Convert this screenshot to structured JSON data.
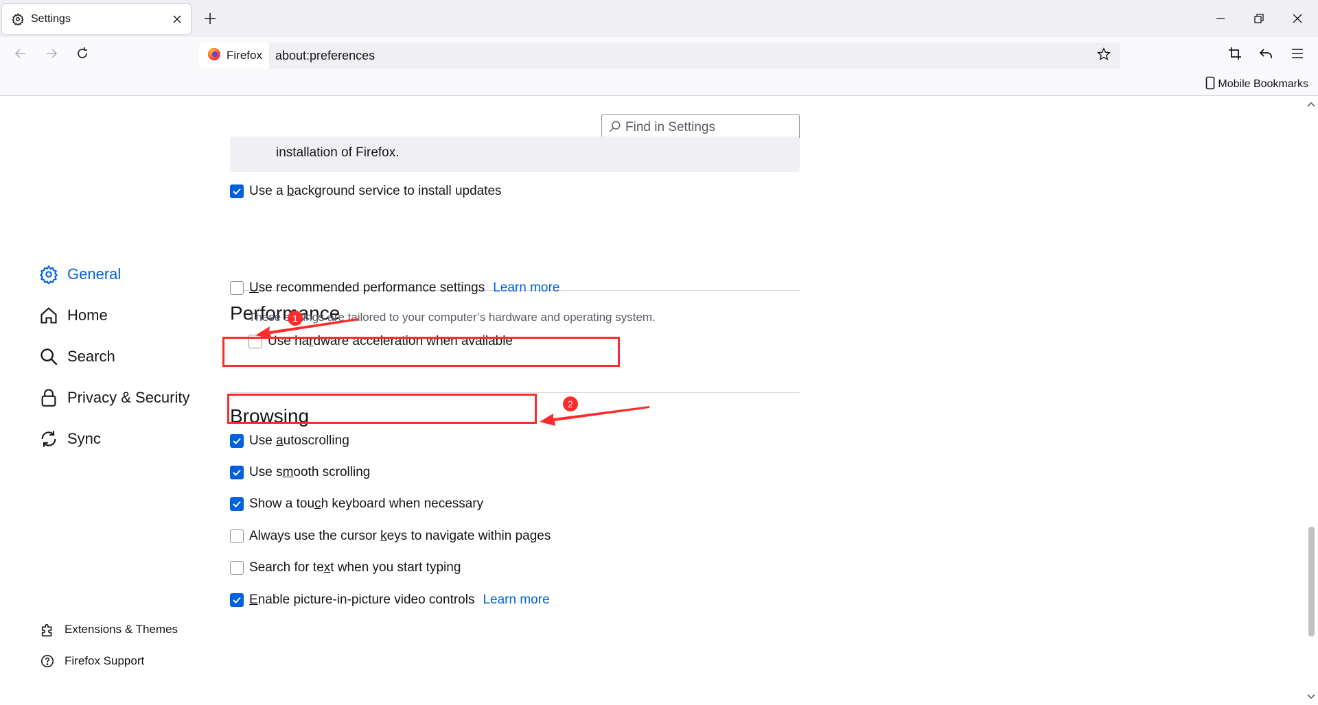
{
  "tab": {
    "title": "Settings",
    "icon": "gear-icon"
  },
  "nav": {
    "identity_label": "Firefox",
    "url": "about:preferences"
  },
  "bookmarks": {
    "mobile": "Mobile Bookmarks"
  },
  "sidebar": {
    "categories": [
      {
        "label": "General",
        "icon": "gear-icon",
        "selected": true
      },
      {
        "label": "Home",
        "icon": "home-icon"
      },
      {
        "label": "Search",
        "icon": "search-icon"
      },
      {
        "label": "Privacy & Security",
        "icon": "lock-icon"
      },
      {
        "label": "Sync",
        "icon": "sync-icon"
      }
    ],
    "footer": [
      {
        "label": "Extensions & Themes",
        "icon": "puzzle-icon"
      },
      {
        "label": "Firefox Support",
        "icon": "help-icon"
      }
    ]
  },
  "search": {
    "placeholder": "Find in Settings"
  },
  "updates": {
    "info_text": "installation of Firefox.",
    "background_service": {
      "pre": "Use a ",
      "key": "b",
      "post": "ackground service to install updates",
      "checked": true
    }
  },
  "performance": {
    "title": "Performance",
    "recommended": {
      "key": "U",
      "post": "se recommended performance settings",
      "learn_more": "Learn more",
      "checked": false
    },
    "description": "These settings are tailored to your computer’s hardware and operating system.",
    "hardware": {
      "pre": "Use ha",
      "key": "r",
      "post": "dware acceleration when available",
      "checked": false
    }
  },
  "browsing": {
    "title": "Browsing",
    "autoscrolling": {
      "pre": "Use ",
      "key": "a",
      "post": "utoscrolling",
      "checked": true
    },
    "smooth": {
      "pre": "Use s",
      "key": "m",
      "post": "ooth scrolling",
      "checked": true
    },
    "touch_keyboard": {
      "pre": "Show a tou",
      "key": "c",
      "post": "h keyboard when necessary",
      "checked": true
    },
    "cursor_keys": {
      "pre": "Always use the cursor ",
      "key": "k",
      "post": "eys to navigate within pages",
      "checked": false
    },
    "search_typing": {
      "pre": "Search for te",
      "key": "x",
      "post": "t when you start typing",
      "checked": false
    },
    "pip": {
      "key": "E",
      "post": "nable picture-in-picture video controls",
      "learn_more": "Learn more",
      "checked": true
    }
  },
  "annotations": {
    "one": "1",
    "two": "2"
  },
  "colors": {
    "accent": "#0061e0",
    "annotation": "#ff2a2a",
    "text": "#15141a",
    "muted": "#5b5b66"
  }
}
